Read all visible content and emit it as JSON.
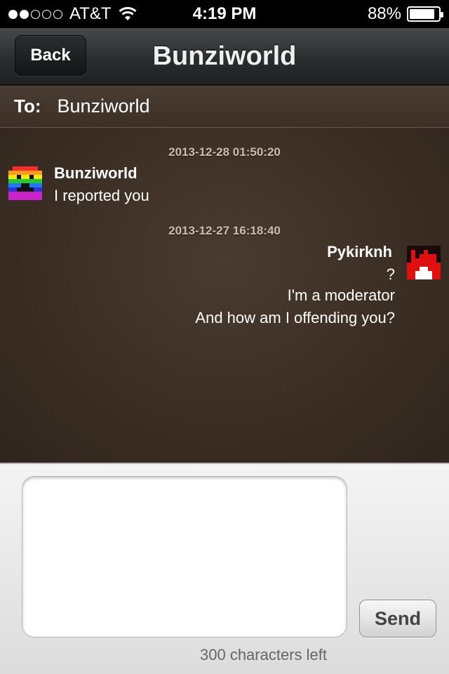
{
  "status_bar": {
    "carrier": "AT&T",
    "signal_bars": 2,
    "signal_total": 5,
    "time": "4:19 PM",
    "battery_text": "88%",
    "battery_level": 0.88,
    "wifi_icon": "wifi-icon",
    "battery_icon": "battery-icon"
  },
  "nav": {
    "back_label": "Back",
    "title": "Bunziworld"
  },
  "to_bar": {
    "label": "To:",
    "recipient": "Bunziworld"
  },
  "messages": [
    {
      "timestamp": "2013-12-28 01:50:20",
      "sender": "Bunziworld",
      "lines": [
        "I reported you"
      ],
      "side": "left"
    },
    {
      "timestamp": "2013-12-27 16:18:40",
      "sender": "Pykirknh",
      "lines": [
        "?",
        "I'm a moderator",
        "And how am I offending you?"
      ],
      "side": "right"
    }
  ],
  "compose": {
    "input_value": "",
    "send_label": "Send",
    "chars_left": "300 characters left"
  },
  "colors": {
    "chat_background": "#3b2e24",
    "nav_background": "#2b2d2f",
    "timestamp": "#c9beb3"
  }
}
